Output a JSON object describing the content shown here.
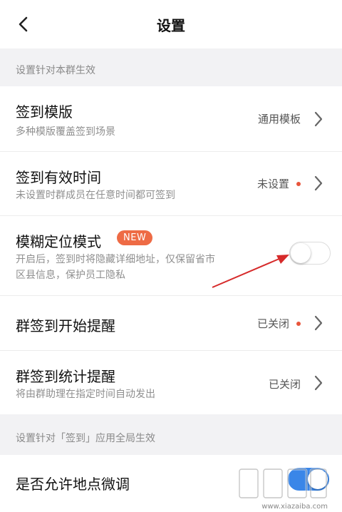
{
  "header": {
    "title": "设置",
    "back_icon": "chevron-left-icon"
  },
  "section1": {
    "label": "设置针对本群生效"
  },
  "rows": [
    {
      "title": "签到模版",
      "desc": "多种模版覆盖签到场景",
      "value": "通用模板",
      "has_dot": false,
      "control": "chevron"
    },
    {
      "title": "签到有效时间",
      "desc": "未设置时群成员在任意时间都可签到",
      "value": "未设置",
      "has_dot": true,
      "control": "chevron"
    },
    {
      "title": "模糊定位模式",
      "badge": "NEW",
      "desc_line1": "开启后，签到时将隐藏详细地址，仅保留省市",
      "desc_line2": "区县信息，保护员工隐私",
      "control": "toggle",
      "toggle_on": false
    },
    {
      "title": "群签到开始提醒",
      "value": "已关闭",
      "has_dot": true,
      "control": "chevron"
    },
    {
      "title": "群签到统计提醒",
      "desc": "将由群助理在指定时间自动发出",
      "value": "已关闭",
      "has_dot": false,
      "control": "chevron"
    }
  ],
  "section2": {
    "label": "设置针对「签到」应用全局生效"
  },
  "row_global": {
    "title": "是否允许地点微调",
    "control": "toggle",
    "toggle_on": true
  },
  "colors": {
    "accent_red": "#e8553b",
    "badge_orange": "#ee6b45",
    "toggle_blue": "#3a86e8",
    "arrow_red": "#d62a2a"
  },
  "watermark": {
    "url": "www.xiazaiba.com"
  }
}
